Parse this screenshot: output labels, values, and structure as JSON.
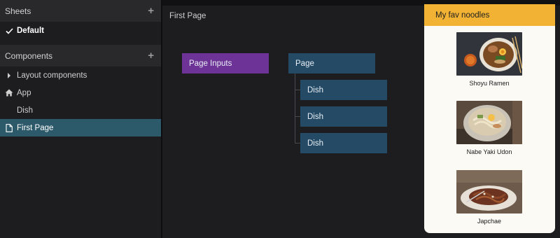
{
  "sidebar": {
    "sheets_header": "Sheets",
    "default_sheet": "Default",
    "components_header": "Components",
    "items": [
      {
        "label": "Layout components"
      },
      {
        "label": "App"
      },
      {
        "label": "Dish"
      },
      {
        "label": "First Page"
      }
    ]
  },
  "canvas": {
    "title": "First Page",
    "nodes": {
      "inputs": "Page Inputs",
      "page": "Page",
      "dishes": [
        "Dish",
        "Dish",
        "Dish"
      ]
    }
  },
  "preview": {
    "header": "My fav noodles",
    "items": [
      {
        "caption": "Shoyu Ramen"
      },
      {
        "caption": "Nabe Yaki Udon"
      },
      {
        "caption": "Japchae"
      }
    ]
  },
  "colors": {
    "active_row": "#2d5a6a",
    "inputs_node": "#6d3396",
    "page_node": "#244a66",
    "preview_header": "#f2b335"
  }
}
